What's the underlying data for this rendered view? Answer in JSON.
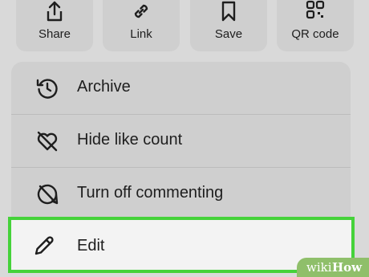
{
  "quick_actions": [
    {
      "label": "Share",
      "icon": "share-icon"
    },
    {
      "label": "Link",
      "icon": "link-icon"
    },
    {
      "label": "Save",
      "icon": "bookmark-icon"
    },
    {
      "label": "QR code",
      "icon": "qr-code-icon"
    }
  ],
  "menu": {
    "items": [
      {
        "label": "Archive",
        "icon": "archive-clock-icon"
      },
      {
        "label": "Hide like count",
        "icon": "heart-off-icon"
      },
      {
        "label": "Turn off commenting",
        "icon": "comment-off-icon"
      },
      {
        "label": "Edit",
        "icon": "pencil-icon"
      }
    ]
  },
  "highlight_color": "#45d23a",
  "watermark": {
    "part1": "wiki",
    "part2": "How"
  }
}
